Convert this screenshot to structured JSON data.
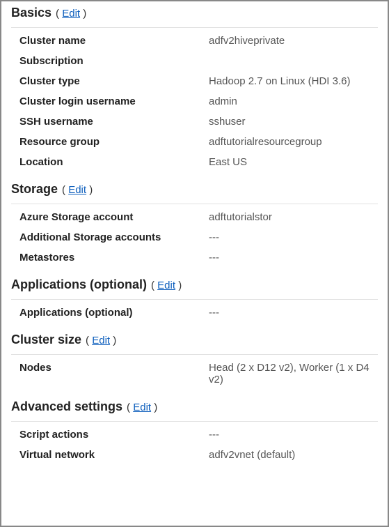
{
  "sections": {
    "basics": {
      "title": "Basics",
      "edit": "Edit",
      "rows": {
        "cluster_name": {
          "label": "Cluster name",
          "value": "adfv2hiveprivate"
        },
        "subscription": {
          "label": "Subscription",
          "value": ""
        },
        "cluster_type": {
          "label": "Cluster type",
          "value": "Hadoop 2.7 on Linux (HDI 3.6)"
        },
        "cluster_login_username": {
          "label": "Cluster login username",
          "value": "admin"
        },
        "ssh_username": {
          "label": "SSH username",
          "value": "sshuser"
        },
        "resource_group": {
          "label": "Resource group",
          "value": "adftutorialresourcegroup"
        },
        "location": {
          "label": "Location",
          "value": "East US"
        }
      }
    },
    "storage": {
      "title": "Storage",
      "edit": "Edit",
      "rows": {
        "azure_storage_account": {
          "label": "Azure Storage account",
          "value": " adftutorialstor"
        },
        "additional_storage_accounts": {
          "label": "Additional Storage accounts",
          "value": "---"
        },
        "metastores": {
          "label": "Metastores",
          "value": "---"
        }
      }
    },
    "applications": {
      "title": "Applications (optional)",
      "edit": "Edit",
      "rows": {
        "applications_optional": {
          "label": "Applications (optional)",
          "value": "---"
        }
      }
    },
    "cluster_size": {
      "title": "Cluster size",
      "edit": "Edit",
      "rows": {
        "nodes": {
          "label": "Nodes",
          "value": "Head (2 x D12 v2), Worker (1 x D4 v2)"
        }
      }
    },
    "advanced_settings": {
      "title": "Advanced settings",
      "edit": "Edit",
      "rows": {
        "script_actions": {
          "label": "Script actions",
          "value": "---"
        },
        "virtual_network": {
          "label": "Virtual network",
          "value": "adfv2vnet (default)"
        }
      }
    }
  }
}
